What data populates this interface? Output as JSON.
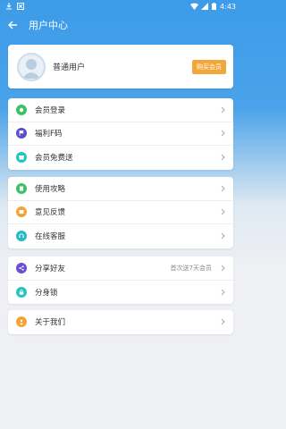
{
  "status": {
    "time": "4:43"
  },
  "appbar": {
    "title": "用户中心"
  },
  "profile": {
    "username": "普通用户",
    "buy_label": "购买会员"
  },
  "groups": [
    {
      "items": [
        {
          "label": "会员登录",
          "icon": "login-icon",
          "color": "#3fbf6a"
        },
        {
          "label": "福利F码",
          "icon": "flag-icon",
          "color": "#5a4fc7"
        },
        {
          "label": "会员免费送",
          "icon": "gift-icon",
          "color": "#28c3c1"
        }
      ]
    },
    {
      "items": [
        {
          "label": "使用攻略",
          "icon": "guide-icon",
          "color": "#3fbf6a"
        },
        {
          "label": "意见反馈",
          "icon": "feedback-icon",
          "color": "#f0a53a"
        },
        {
          "label": "在线客服",
          "icon": "headset-icon",
          "color": "#28b8c8"
        }
      ]
    },
    {
      "items": [
        {
          "label": "分享好友",
          "icon": "share-icon",
          "color": "#6a4fd1",
          "extra": "首次送7天会员"
        },
        {
          "label": "分身锁",
          "icon": "lock-icon",
          "color": "#28c3c1"
        }
      ]
    },
    {
      "items": [
        {
          "label": "关于我们",
          "icon": "about-icon",
          "color": "#f0a53a"
        }
      ]
    }
  ]
}
